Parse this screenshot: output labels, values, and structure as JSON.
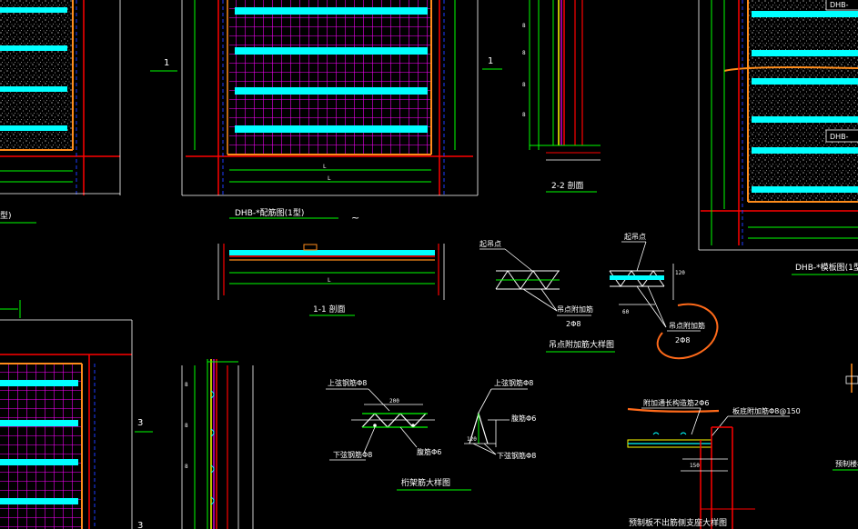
{
  "drawing": {
    "plan_left_marks": [
      "1",
      "1"
    ],
    "plan_dims": {
      "left_dim": "L",
      "main_dim": "L"
    },
    "plan_title": "DHB-*配筋图(1型)",
    "plan_title_left": "型)",
    "plan_title_right": "DHB-*模板图(1型",
    "section_22_title": "2-2 剖面",
    "section_11_title": "1-1 剖面",
    "right_panel_labels": [
      "DHB-",
      "DHB-"
    ],
    "section_mark_3": [
      "3",
      "3"
    ],
    "hook_detail": {
      "label_left": "起吊点",
      "label_right": "起吊点",
      "rebar_left": "吊点附加筋",
      "rebar_left_sub": "2Φ8",
      "rebar_right": "吊点附加筋",
      "rebar_right_sub": "2Φ8",
      "title": "吊点附加筋大样图"
    },
    "truss_detail": {
      "top_bar": "上弦钢筋Φ8",
      "top_bar_2": "上弦钢筋Φ8",
      "bottom_bar": "下弦钢筋Φ8",
      "bottom_bar_2": "下弦钢筋Φ8",
      "web_bar": "腹筋Φ6",
      "web_bar_2": "腹筋Φ6",
      "title": "桁架筋大样图"
    },
    "support_detail": {
      "label_1": "附加通长构造筋2Φ6",
      "label_2": "板底附加筋Φ8@150",
      "title": "预制板不出筋侧支座大样图",
      "right_cut": "预制楼板"
    },
    "numbers": {
      "n120": "120",
      "n200": "200"
    }
  },
  "colors": {
    "cyan": "#00ffff",
    "magenta": "#ff00ff",
    "red": "#ff0000",
    "orange": "#ff8c1a",
    "yellow": "#ffff00",
    "green": "#00ff00",
    "white": "#ffffff",
    "blue": "#1e3cff",
    "annotation": "#ff6a1a"
  }
}
